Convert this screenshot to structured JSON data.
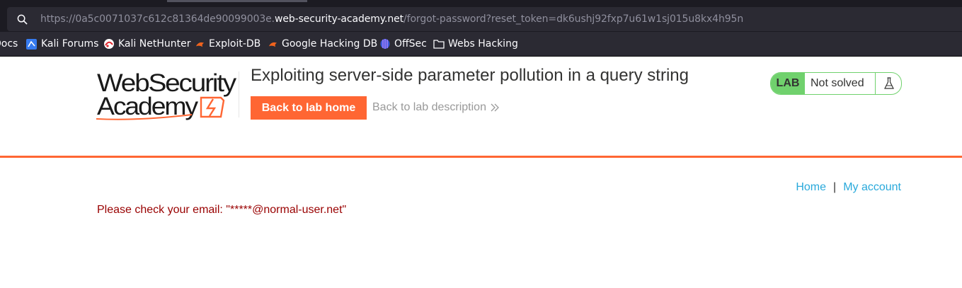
{
  "browser": {
    "url_prefix": "https://0a5c0071037c612c81364de90099003e.",
    "url_domain": "web-security-academy.net",
    "url_suffix": "/forgot-password?reset_token=dk6ushj92fxp7u61w1sj015u8kx4h95n",
    "bookmarks": [
      {
        "label": "Docs",
        "icon": "none"
      },
      {
        "label": "Kali Forums",
        "icon": "kali-forums-icon"
      },
      {
        "label": "Kali NetHunter",
        "icon": "kali-nethunter-icon"
      },
      {
        "label": "Exploit-DB",
        "icon": "exploit-db-icon"
      },
      {
        "label": "Google Hacking DB",
        "icon": "ghdb-icon"
      },
      {
        "label": "OffSec",
        "icon": "offsec-icon"
      },
      {
        "label": "Webs Hacking",
        "icon": "folder-icon"
      }
    ]
  },
  "header": {
    "logo_line1": "WebSecurity",
    "logo_line2": "Academy",
    "title": "Exploiting server-side parameter pollution in a query string",
    "back_home": "Back to lab home",
    "back_description": "Back to lab description",
    "lab_badge": "LAB",
    "status": "Not solved"
  },
  "nav": {
    "home": "Home",
    "separator": "|",
    "my_account": "My account"
  },
  "message": "Please check your email: \"*****@normal-user.net\"",
  "colors": {
    "accent_orange": "#ff6633",
    "status_green": "#70d16d",
    "link_blue": "#29a9db",
    "error_red": "#990000"
  }
}
